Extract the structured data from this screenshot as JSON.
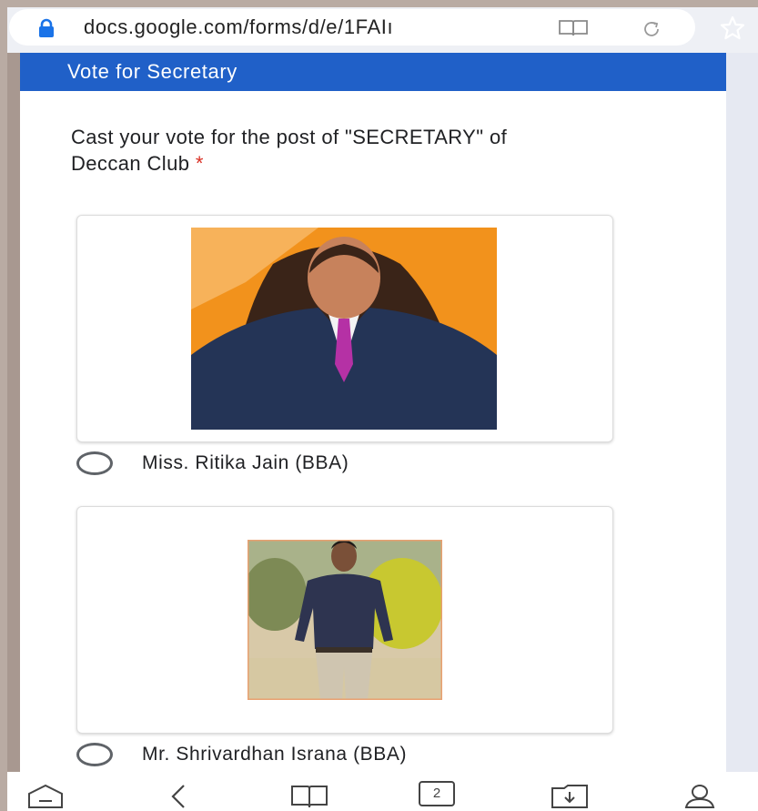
{
  "browser": {
    "url": "docs.google.com/forms/d/e/1FAIı"
  },
  "form": {
    "section_title": "Vote for Secretary",
    "question": "Cast your vote for the post of \"SECRETARY\" of Deccan Club",
    "required_marker": "*",
    "options": [
      {
        "label": "Miss. Ritika Jain (BBA)"
      },
      {
        "label": "Mr. Shrivardhan Israna (BBA)"
      }
    ]
  },
  "nav": {
    "tab_count": "2"
  },
  "colors": {
    "header_blue": "#2060c8",
    "required_red": "#d93025",
    "frame": "#b9aba3"
  }
}
